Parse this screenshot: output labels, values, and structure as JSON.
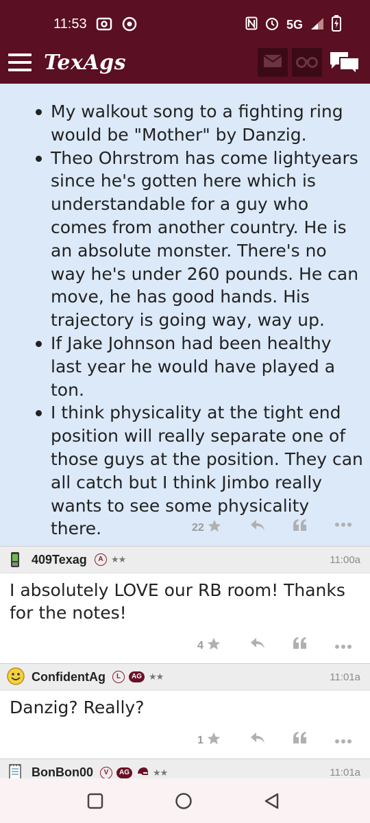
{
  "status_bar": {
    "time": "11:53",
    "network": "5G"
  },
  "app": {
    "logo": "TexAgs",
    "icons": [
      "menu-icon",
      "mail-icon",
      "binoculars-icon",
      "chat-icon"
    ]
  },
  "main_post": {
    "bullets": [
      "My walkout song to a fighting ring would be \"Mother\" by Danzig.",
      "Theo Ohrstrom has come lightyears since he's gotten here which is understandable for a guy who comes from another country. He is an absolute monster. There's no way he's under 260 pounds. He can move, he has good hands. His trajectory is going way, way up.",
      "If Jake Johnson had been healthy last year he would have played a ton.",
      "I think physicality at the tight end position will really separate one of those guys at the position. They can all catch but I think Jimbo really wants to see some physicality there."
    ],
    "star_count": "22"
  },
  "replies": [
    {
      "username": "409Texag",
      "badges": [
        "A"
      ],
      "rating": "★★",
      "time": "11:00a",
      "body": "I absolutely LOVE our RB room! Thanks for the notes!",
      "star_count": "4"
    },
    {
      "username": "ConfidentAg",
      "badges": [
        "L",
        "AG"
      ],
      "rating": "★★",
      "time": "11:01a",
      "body": "Danzig? Really?",
      "star_count": "1"
    },
    {
      "username": "BonBon00",
      "badges": [
        "V",
        "AG"
      ],
      "rating": "★★",
      "time": "11:01a"
    }
  ],
  "colors": {
    "brand_maroon": "#5a0f22",
    "post_highlight": "#dbe9f9",
    "header_gray": "#ededed"
  }
}
